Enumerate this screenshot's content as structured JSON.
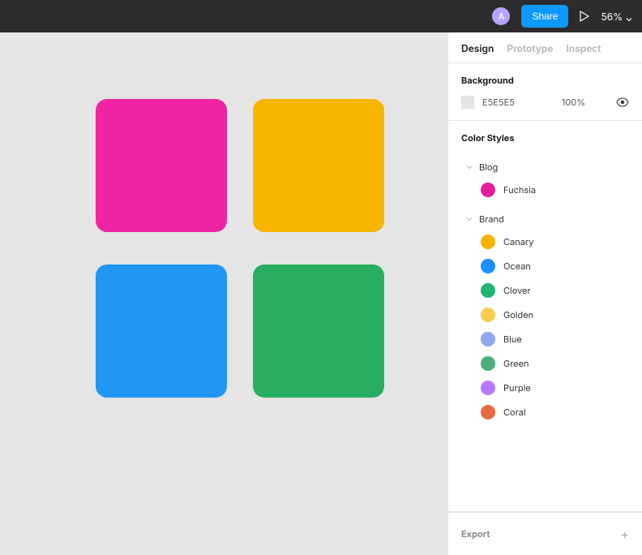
{
  "topbar": {
    "avatar_initial": "A",
    "share_label": "Share",
    "zoom_label": "56%"
  },
  "tabs": {
    "design": "Design",
    "prototype": "Prototype",
    "inspect": "Inspect"
  },
  "background": {
    "title": "Background",
    "hex": "E5E5E5",
    "opacity": "100%",
    "swatch_color": "#e5e5e5"
  },
  "color_styles": {
    "title": "Color Styles",
    "groups": [
      {
        "name": "Blog",
        "items": [
          {
            "name": "Fuchsia",
            "color": "#e21f9a"
          }
        ]
      },
      {
        "name": "Brand",
        "items": [
          {
            "name": "Canary",
            "color": "#f5b400"
          },
          {
            "name": "Ocean",
            "color": "#1e90ff"
          },
          {
            "name": "Clover",
            "color": "#22b573"
          },
          {
            "name": "Golden",
            "color": "#f6cf4f"
          },
          {
            "name": "Blue",
            "color": "#8fa7ee"
          },
          {
            "name": "Green",
            "color": "#4cae7b"
          },
          {
            "name": "Purple",
            "color": "#b47bff"
          },
          {
            "name": "Coral",
            "color": "#e86b3f"
          }
        ]
      }
    ]
  },
  "export": {
    "title": "Export"
  },
  "canvas": {
    "background": "#e5e5e5",
    "shapes": [
      {
        "pos": "tl",
        "color": "#ef24a4"
      },
      {
        "pos": "tr",
        "color": "#f8b500"
      },
      {
        "pos": "bl",
        "color": "#2196f3"
      },
      {
        "pos": "br",
        "color": "#27ae60"
      }
    ]
  }
}
